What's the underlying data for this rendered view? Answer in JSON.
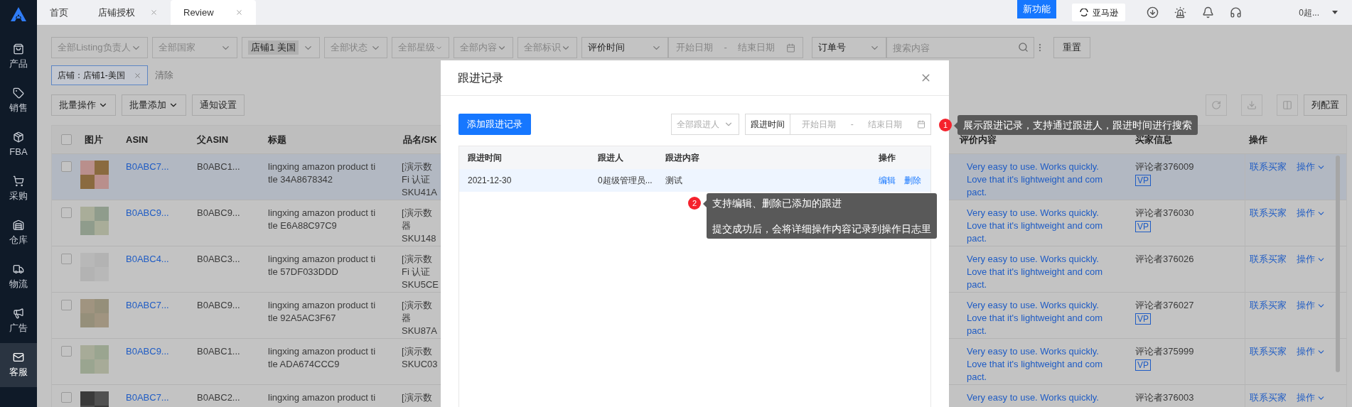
{
  "sidebar": {
    "items": [
      {
        "label": "产品",
        "selected": false
      },
      {
        "label": "销售",
        "selected": false
      },
      {
        "label": "FBA",
        "selected": false
      },
      {
        "label": "采购",
        "selected": false
      },
      {
        "label": "仓库",
        "selected": false
      },
      {
        "label": "物流",
        "selected": false
      },
      {
        "label": "广告",
        "selected": false
      },
      {
        "label": "客服",
        "selected": true
      }
    ]
  },
  "tabs": [
    {
      "label": "首页",
      "closable": false,
      "selected": false
    },
    {
      "label": "店铺授权",
      "closable": true,
      "selected": false
    },
    {
      "label": "Review",
      "closable": true,
      "selected": true
    }
  ],
  "header": {
    "new_badge": "新功能",
    "store_button": "亚马逊",
    "user": "0超..."
  },
  "filters": {
    "selects": [
      {
        "label": "全部Listing负责人",
        "kind": "placeholder"
      },
      {
        "label": "全部国家",
        "kind": "placeholder"
      },
      {
        "label": "店铺1 美国",
        "kind": "tag"
      },
      {
        "label": "全部状态",
        "kind": "placeholder"
      },
      {
        "label": "全部星级",
        "kind": "placeholder"
      },
      {
        "label": "全部内容",
        "kind": "placeholder"
      },
      {
        "label": "全部标识",
        "kind": "placeholder"
      },
      {
        "label": "评价时间",
        "kind": "value"
      }
    ],
    "date_start": "开始日期",
    "date_separator": "-",
    "date_end": "结束日期",
    "search_field": "订单号",
    "search_placeholder": "搜索内容",
    "reset": "重置"
  },
  "active_filters": [
    {
      "label": "店铺：店铺1-美国"
    }
  ],
  "clear": "清除",
  "toolbar": {
    "buttons": [
      {
        "label": "批量操作",
        "dropdown": true
      },
      {
        "label": "批量添加",
        "dropdown": true
      },
      {
        "label": "通知设置",
        "dropdown": false
      }
    ],
    "column_config": "列配置"
  },
  "table": {
    "header_checked": false,
    "columns": [
      "图片",
      "ASIN",
      "父ASIN",
      "标题",
      "品名/SK",
      "评价内容",
      "买家信息",
      "操作"
    ],
    "rows": [
      {
        "highlighted": true,
        "checked": false,
        "asin": "B0ABC7...",
        "parent_asin": "B0ABC1...",
        "title": [
          "lingxing amazon product ti",
          "tle 34A8678342"
        ],
        "product": [
          "[演示数",
          "Fi 认证",
          "SKU41A"
        ],
        "review": [
          "Very easy to use. Works quickly.",
          "Love that it's lightweight and com",
          "pact."
        ],
        "buyer": "评论者376009",
        "vp": true,
        "vp_label": "VP",
        "contact": "联系买家",
        "action": "操作"
      },
      {
        "highlighted": false,
        "checked": false,
        "asin": "B0ABC9...",
        "parent_asin": "B0ABC9...",
        "title": [
          "lingxing amazon product ti",
          "tle E6A88C97C9"
        ],
        "product": [
          "[演示数",
          "器",
          "SKU148"
        ],
        "review": [
          "Very easy to use. Works quickly.",
          "Love that it's lightweight and com",
          "pact."
        ],
        "buyer": "评论者376030",
        "vp": true,
        "vp_label": "VP",
        "contact": "联系买家",
        "action": "操作"
      },
      {
        "highlighted": false,
        "checked": false,
        "asin": "B0ABC4...",
        "parent_asin": "B0ABC3...",
        "title": [
          "lingxing amazon product ti",
          "tle 57DF033DDD"
        ],
        "product": [
          "[演示数",
          "Fi 认证",
          "SKU5CE"
        ],
        "review": [
          "Very easy to use. Works quickly.",
          "Love that it's lightweight and com",
          "pact."
        ],
        "buyer": "评论者376026",
        "vp": false,
        "contact": "联系买家",
        "action": "操作"
      },
      {
        "highlighted": false,
        "checked": false,
        "asin": "B0ABC7...",
        "parent_asin": "B0ABC9...",
        "title": [
          "lingxing amazon product ti",
          "tle 92A5AC3F67"
        ],
        "product": [
          "[演示数",
          "器",
          "SKU87A"
        ],
        "review": [
          "Very easy to use. Works quickly.",
          "Love that it's lightweight and com",
          "pact."
        ],
        "buyer": "评论者376027",
        "vp": true,
        "vp_label": "VP",
        "contact": "联系买家",
        "action": "操作"
      },
      {
        "highlighted": false,
        "checked": false,
        "asin": "B0ABC9...",
        "parent_asin": "B0ABC1...",
        "title": [
          "lingxing amazon product ti",
          "tle ADA674CCC9"
        ],
        "product": [
          "[演示数",
          "SKUC03"
        ],
        "review": [
          "Very easy to use. Works quickly.",
          "Love that it's lightweight and com",
          "pact."
        ],
        "buyer": "评论者375999",
        "vp": true,
        "vp_label": "VP",
        "contact": "联系买家",
        "action": "操作"
      },
      {
        "highlighted": false,
        "checked": false,
        "asin": "B0ABC7...",
        "parent_asin": "B0ABC2...",
        "title": [
          "lingxing amazon product ti"
        ],
        "product": [
          "[演示数"
        ],
        "review": [
          "Very easy to use. Works quickly."
        ],
        "buyer": "评论者376003",
        "vp": false,
        "contact": "联系买家",
        "action": "操作"
      }
    ]
  },
  "modal": {
    "title": "跟进记录",
    "add_button": "添加跟进记录",
    "person_select": "全部跟进人",
    "date_label": "跟进时间",
    "date_start": "开始日期",
    "date_separator": "-",
    "date_end": "结束日期",
    "columns": [
      "跟进时间",
      "跟进人",
      "跟进内容",
      "操作"
    ],
    "rows": [
      {
        "time": "2021-12-30",
        "person": "0超级管理员...",
        "content": "测试",
        "actions": [
          "编辑",
          "删除"
        ]
      }
    ]
  },
  "tips": [
    {
      "number": "1",
      "lines": [
        "展示跟进记录，支持通过跟进人，跟进时间进行搜索"
      ]
    },
    {
      "number": "2",
      "lines": [
        "支持编辑、删除已添加的跟进",
        "提交成功后，会将详细操作内容记录到操作日志里"
      ]
    }
  ]
}
